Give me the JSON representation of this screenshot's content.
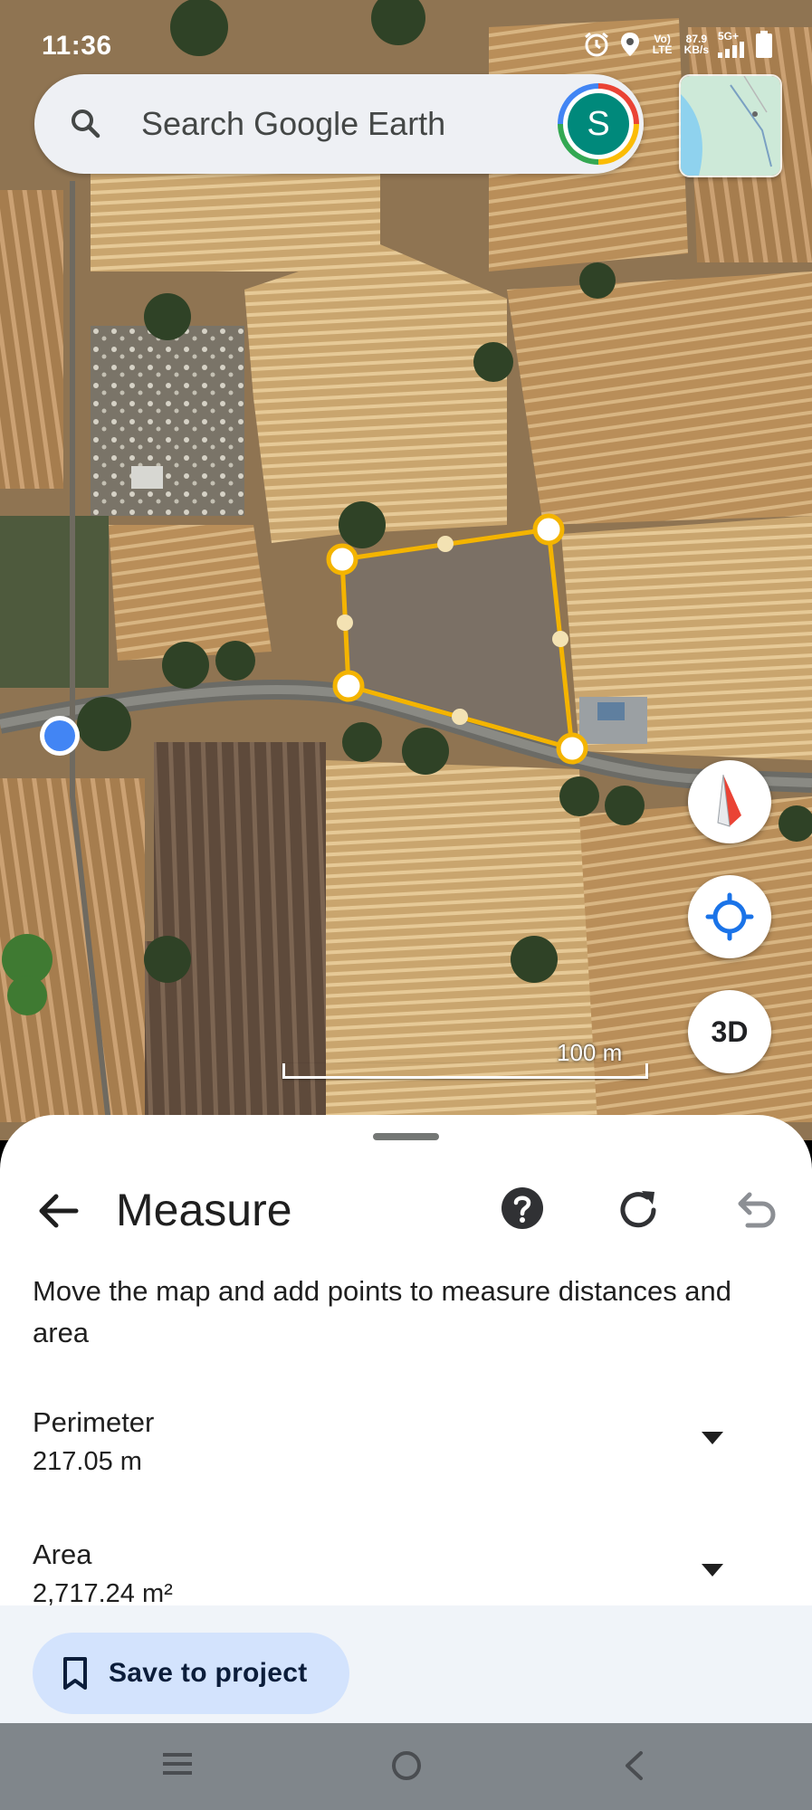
{
  "status_bar": {
    "time": "11:36",
    "net_type": "Vo) LTE",
    "speed_value": "87.9",
    "speed_unit": "KB/s",
    "signal_label": "5G+"
  },
  "search": {
    "placeholder": "Search Google Earth",
    "avatar_letter": "S"
  },
  "map": {
    "scale_label": "100 m",
    "three_d_label": "3D",
    "accent_color": "#f4b400",
    "location_dot_color": "#4285f4"
  },
  "sheet": {
    "title": "Measure",
    "instructions": "Move the map and add points to measure distances and area",
    "metrics": [
      {
        "label": "Perimeter",
        "value": "217.05 m"
      },
      {
        "label": "Area",
        "value": "2,717.24 m²"
      }
    ],
    "save_label": "Save to project"
  },
  "icons": {
    "search": "search-icon",
    "back": "arrow-back-icon",
    "help": "help-circle-icon",
    "reset": "refresh-icon",
    "undo": "undo-icon",
    "bookmark": "bookmark-icon",
    "compass": "compass-icon",
    "locate": "my-location-icon"
  }
}
